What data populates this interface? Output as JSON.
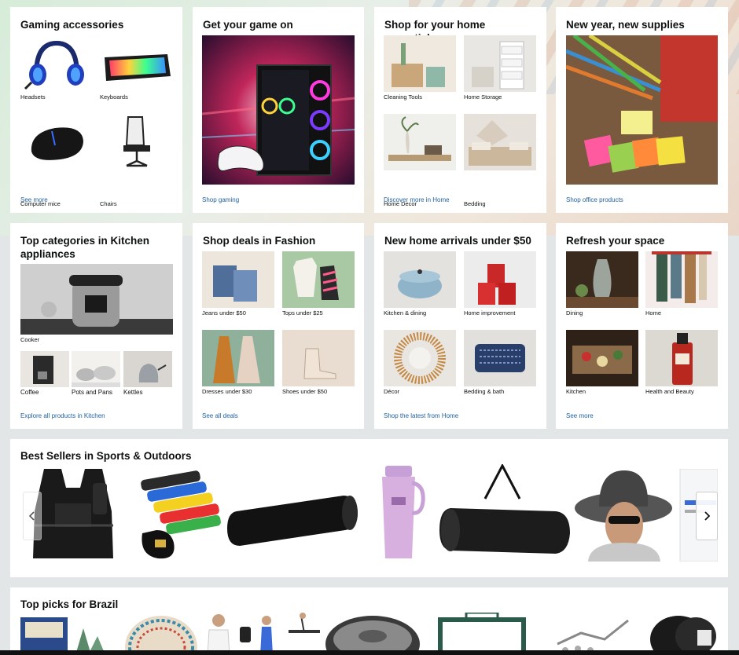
{
  "cards_row1": [
    {
      "title": "Gaming accessories",
      "items": [
        "Headsets",
        "Keyboards",
        "Computer mice",
        "Chairs"
      ],
      "link": "See more"
    },
    {
      "title": "Get your game on",
      "link": "Shop gaming"
    },
    {
      "title": "Shop for your home essentials",
      "items": [
        "Cleaning Tools",
        "Home Storage",
        "Home Decor",
        "Bedding"
      ],
      "link": "Discover more in Home"
    },
    {
      "title": "New year, new supplies",
      "link": "Shop office products"
    }
  ],
  "cards_row2": [
    {
      "title": "Top categories in Kitchen appliances",
      "hero_caption": "Cooker",
      "items": [
        "Coffee",
        "Pots and Pans",
        "Kettles"
      ],
      "link": "Explore all products in Kitchen"
    },
    {
      "title": "Shop deals in Fashion",
      "items": [
        "Jeans under $50",
        "Tops under $25",
        "Dresses under $30",
        "Shoes under $50"
      ],
      "link": "See all deals"
    },
    {
      "title": "New home arrivals under $50",
      "items": [
        "Kitchen & dining",
        "Home improvement",
        "Décor",
        "Bedding & bath"
      ],
      "link": "Shop the latest from Home"
    },
    {
      "title": "Refresh your space",
      "items": [
        "Dining",
        "Home",
        "Kitchen",
        "Health and Beauty"
      ],
      "link": "See more"
    }
  ],
  "best_sellers": {
    "title": "Best Sellers in Sports & Outdoors",
    "icons": {
      "prev": "chevron-left-icon",
      "next": "chevron-right-icon"
    },
    "products": [
      "weighted-vest",
      "resistance-bands",
      "foam-roller",
      "tumbler",
      "yoga-mat",
      "sun-hat",
      "product-box"
    ]
  },
  "top_picks": {
    "title": "Top picks for Brazil"
  },
  "colors": {
    "link": "#2162a1",
    "page_bg": "#e3e6e6",
    "card_bg": "#ffffff"
  }
}
